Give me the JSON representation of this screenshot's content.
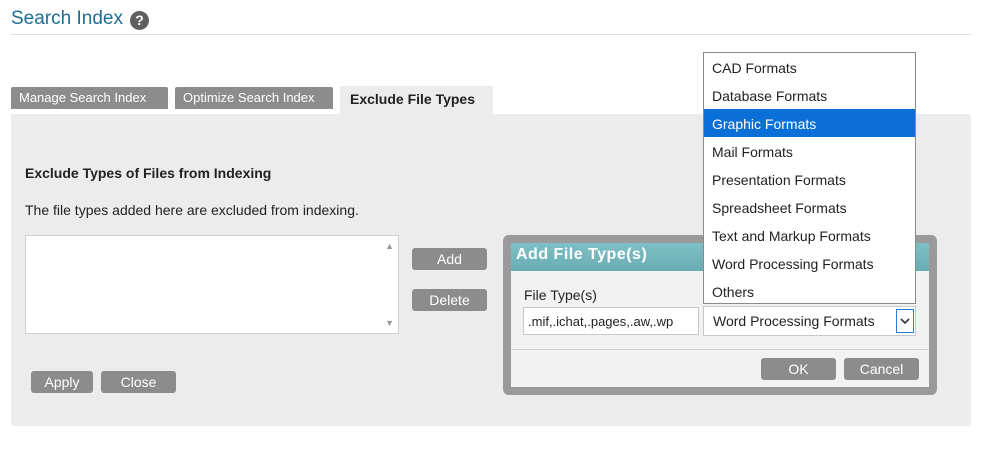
{
  "header": {
    "title": "Search Index",
    "help_glyph": "?"
  },
  "tabs": [
    {
      "label": "Manage Search Index"
    },
    {
      "label": "Optimize Search Index"
    },
    {
      "label": "Exclude File Types",
      "active": true
    }
  ],
  "section": {
    "heading": "Exclude Types of Files from Indexing",
    "description": "The file types added here are excluded from indexing."
  },
  "side_buttons": {
    "add": "Add",
    "delete": "Delete"
  },
  "footer_buttons": {
    "apply": "Apply",
    "close": "Close"
  },
  "dialog": {
    "title": "Add File Type(s)",
    "field_label": "File Type(s)",
    "file_types_value": ".mif,.ichat,.pages,.aw,.wp",
    "selected_category": "Word Processing Formats",
    "ok": "OK",
    "cancel": "Cancel"
  },
  "dropdown": {
    "options": [
      "CAD Formats",
      "Database Formats",
      "Graphic Formats",
      "Mail Formats",
      "Presentation Formats",
      "Spreadsheet Formats",
      "Text and Markup Formats",
      "Word Processing Formats",
      "Others"
    ],
    "highlighted": "Graphic Formats"
  },
  "colors": {
    "title": "#1f6d93",
    "tab_bg": "#8c8c8c",
    "panel_bg": "#ececec",
    "dialog_header": "#7fc0c6",
    "highlight": "#0a6fd6"
  }
}
